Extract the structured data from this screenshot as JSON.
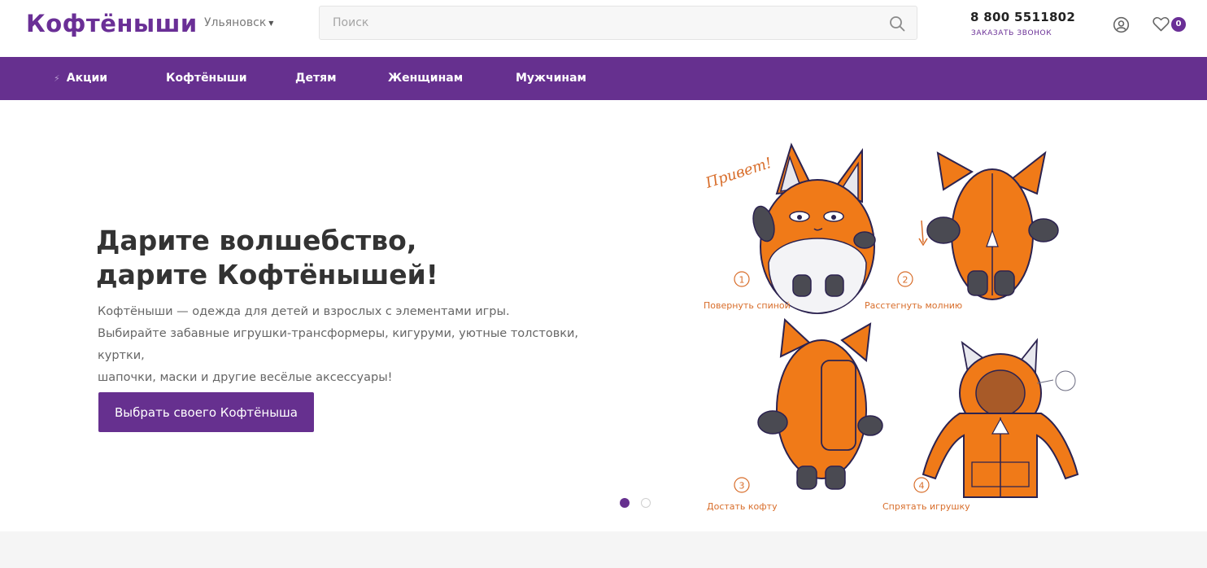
{
  "header": {
    "logo": "Кофтёныши",
    "city": "Ульяновск",
    "search_placeholder": "Поиск",
    "phone": "8 800 5511802",
    "callback": "ЗАКАЗАТЬ ЗВОНОК",
    "favorites_count": "0"
  },
  "nav": {
    "items": [
      {
        "label": "Акции",
        "icon": "bolt-icon"
      },
      {
        "label": "Кофтёныши"
      },
      {
        "label": "Детям"
      },
      {
        "label": "Женщинам"
      },
      {
        "label": "Мужчинам"
      }
    ]
  },
  "hero": {
    "title_line1": "Дарите волшебство,",
    "title_line2": "дарите Кофтёнышей!",
    "desc_line1": "Кофтёныши — одежда для детей и взрослых с элементами игры.",
    "desc_line2": "Выбирайте забавные игрушки-трансформеры, кигуруми, уютные толстовки, куртки,",
    "desc_line3": "шапочки, маски и другие весёлые аксессуары!",
    "cta": "Выбрать своего Кофтёныша",
    "slides_total": 2,
    "slide_active": 1
  },
  "illustration": {
    "greeting": "Привет!",
    "steps": [
      {
        "num": "1",
        "label": "Повернуть спиной"
      },
      {
        "num": "2",
        "label": "Расстегнуть молнию"
      },
      {
        "num": "3",
        "label": "Достать кофту"
      },
      {
        "num": "4",
        "label": "Спрятать игрушку"
      }
    ]
  },
  "colors": {
    "brand": "#66308f",
    "accent_orange": "#f07a18"
  }
}
